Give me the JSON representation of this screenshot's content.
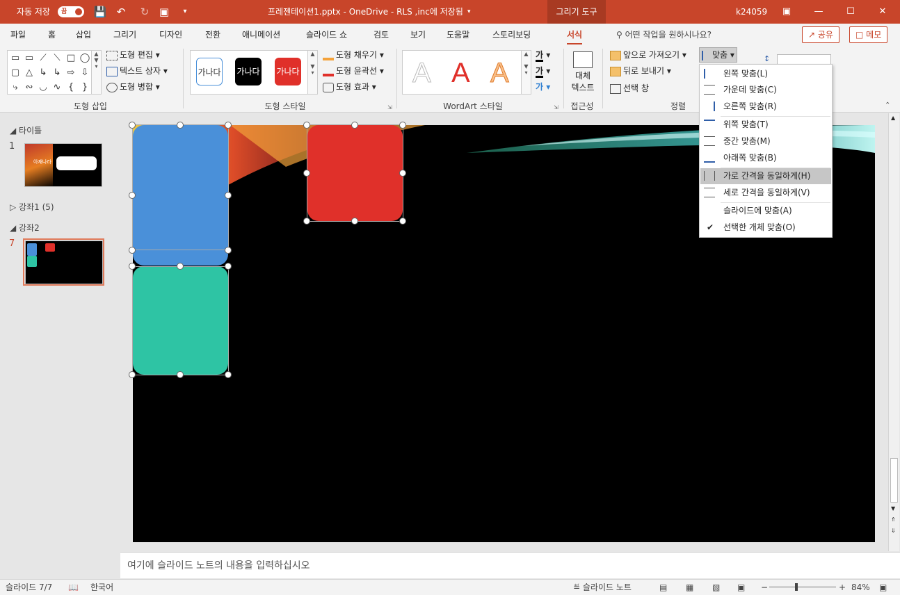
{
  "titlebar": {
    "autosave_label": "자동 저장",
    "autosave_toggle": "끔",
    "file_title": "프레젠테이션1.pptx  -  OneDrive - RLS ,inc에 저장됨",
    "context_tab": "그리기 도구",
    "user": "k24059"
  },
  "tabs": [
    "파일",
    "홈",
    "삽입",
    "그리기",
    "디자인",
    "전환",
    "애니메이션",
    "슬라이드 쇼",
    "검토",
    "보기",
    "도움말",
    "스토리보딩",
    "서식"
  ],
  "active_tab": "서식",
  "tell_me": "어떤 작업을 원하시나요?",
  "share": "공유",
  "comments": "메모",
  "ribbon": {
    "insert_shapes": {
      "label": "도형 삽입",
      "edit_shape": "도형 편집",
      "text_box": "텍스트 상자",
      "merge_shapes": "도형 병합"
    },
    "shape_styles": {
      "label": "도형 스타일",
      "sample_text": "가나다",
      "fill": "도형 채우기",
      "outline": "도형 윤곽선",
      "effects": "도형 효과"
    },
    "wordart": {
      "label": "WordArt 스타일",
      "letter": "A",
      "text_glyph": "가"
    },
    "accessibility": {
      "label": "접근성",
      "alt_text_line1": "대체",
      "alt_text_line2": "텍스트"
    },
    "arrange": {
      "label": "정렬",
      "bring_forward": "앞으로 가져오기",
      "send_backward": "뒤로 보내기",
      "selection_pane": "선택 창",
      "align": "맞춤"
    }
  },
  "align_menu": [
    {
      "label": "왼쪽 맞춤(L)",
      "icon": "align-left-icon"
    },
    {
      "label": "가운데 맞춤(C)",
      "icon": "align-center-icon"
    },
    {
      "label": "오른쪽 맞춤(R)",
      "icon": "align-right-icon"
    },
    {
      "label": "위쪽 맞춤(T)",
      "icon": "align-top-icon"
    },
    {
      "label": "중간 맞춤(M)",
      "icon": "align-middle-icon"
    },
    {
      "label": "아래쪽 맞춤(B)",
      "icon": "align-bottom-icon"
    },
    {
      "label": "가로 간격을 동일하게(H)",
      "icon": "distribute-horizontal-icon"
    },
    {
      "label": "세로 간격을 동일하게(V)",
      "icon": "distribute-vertical-icon"
    },
    {
      "label": "슬라이드에 맞춤(A)",
      "icon": ""
    },
    {
      "label": "선택한 개체 맞춤(O)",
      "icon": "check-icon"
    }
  ],
  "slide_panel": {
    "sections": [
      "타이틀",
      "강좌1 (5)",
      "강좌2"
    ],
    "slide_numbers": [
      "1",
      "7"
    ],
    "thumb1_title": "아재나라"
  },
  "notes_placeholder": "여기에 슬라이드 노트의 내용을 입력하십시오",
  "status": {
    "slide_info": "슬라이드 7/7",
    "language": "한국어",
    "notes_btn": "슬라이드 노트",
    "zoom": "84%"
  },
  "colors": {
    "accent": "#c8452a",
    "shape_blue": "#4a90d9",
    "shape_red": "#e0302a",
    "shape_teal": "#2ec4a4"
  }
}
